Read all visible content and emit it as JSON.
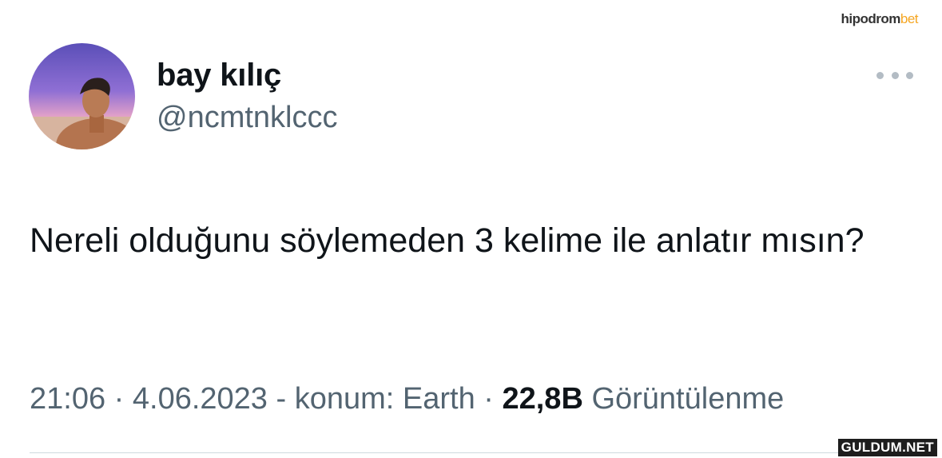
{
  "watermark_top": {
    "main": "hipodrom",
    "accent": "bet"
  },
  "user": {
    "display_name": "bay kılıç",
    "handle": "@ncmtnklccc"
  },
  "more_icon": "ellipsis-icon",
  "tweet": {
    "text": "Nereli olduğunu söylemeden 3 kelime ile anlatır mısın?"
  },
  "meta": {
    "time": "21:06",
    "separator1": " · ",
    "date": "4.06.2023",
    "location": " - konum: Earth",
    "separator2": " · ",
    "views_count": "22,8B",
    "views_label": " Görüntülenme"
  },
  "watermark_bottom": "GULDUM.NET",
  "colors": {
    "text_primary": "#0f1419",
    "text_secondary": "#536471",
    "divider": "#cfd9de",
    "more_dots": "#b3bcc4",
    "brand_accent": "#f5a623"
  }
}
